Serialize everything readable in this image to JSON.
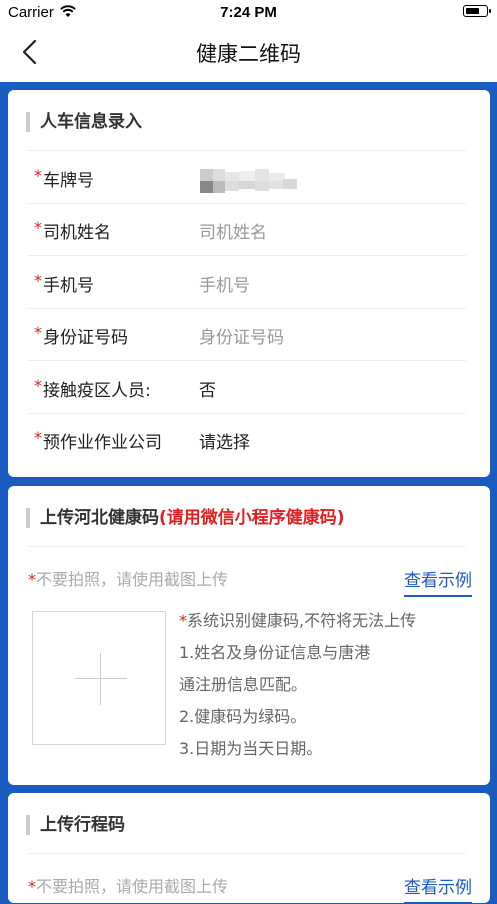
{
  "status": {
    "carrier": "Carrier",
    "time": "7:24 PM"
  },
  "nav": {
    "title": "健康二维码"
  },
  "vehicle_section": {
    "title": "人车信息录入",
    "rows": [
      {
        "label": "车牌号",
        "value": ""
      },
      {
        "label": "司机姓名",
        "placeholder": "司机姓名"
      },
      {
        "label": "手机号",
        "placeholder": "手机号"
      },
      {
        "label": "身份证号码",
        "placeholder": "身份证号码"
      },
      {
        "label": "接触疫区人员:",
        "value": "否"
      },
      {
        "label": "预作业作业公司",
        "value": "请选择"
      }
    ]
  },
  "health_section": {
    "title": "上传河北健康码",
    "title_note": "(请用微信小程序健康码)",
    "hint": "不要拍照，请使用截图上传",
    "example_link": "查看示例",
    "notes": [
      "系统识别健康码,不符将无法上传",
      "1.姓名及身份证信息与唐港",
      "通注册信息匹配。",
      "2.健康码为绿码。",
      "3.日期为当天日期。"
    ]
  },
  "trip_section": {
    "title": "上传行程码",
    "hint": "不要拍照，请使用截图上传",
    "example_link": "查看示例"
  },
  "required_mark": "*",
  "colors": {
    "primary": "#1a5bbf",
    "required": "#e02020",
    "placeholder": "#999999"
  }
}
